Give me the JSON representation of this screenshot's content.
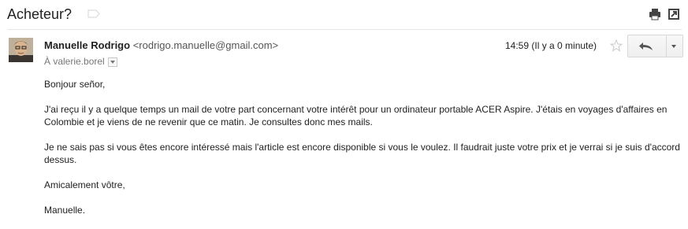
{
  "thread": {
    "subject": "Acheteur?"
  },
  "message": {
    "sender_name": "Manuelle Rodrigo",
    "sender_email": "<rodrigo.manuelle@gmail.com>",
    "recipient": "À valerie.borel",
    "timestamp": "14:59 (Il y a 0 minute)",
    "greeting": "Bonjour señor,",
    "paragraph_1": "J'ai reçu il y a quelque temps un mail de votre part concernant votre intérêt pour un ordinateur portable ACER Aspire. J'étais en voyages d'affaires en Colombie et je viens de ne revenir que ce matin. Je consultes donc mes mails.",
    "paragraph_2": "Je ne sais pas si vous êtes encore intéressé mais l'article est encore disponible si vous le voulez. Il faudrait juste votre prix et je verrai si je suis d'accord dessus.",
    "closing": "Amicalement vôtre,",
    "signature": "Manuelle."
  },
  "icons": {
    "label": "label-tag-icon",
    "print": "print-icon",
    "new_window": "new-window-icon",
    "star": "star-icon",
    "reply": "reply-arrow-icon",
    "more": "chevron-down-icon"
  },
  "colors": {
    "text": "#222222",
    "muted": "#777777",
    "divider": "#e5e5e5",
    "button_border": "#d8d8d8"
  }
}
